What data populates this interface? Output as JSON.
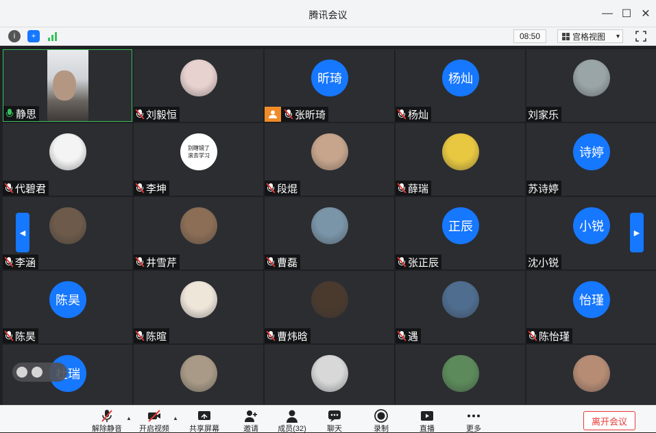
{
  "window": {
    "title": "腾讯会议",
    "minimize": "—",
    "maximize": "☐",
    "close": "✕"
  },
  "toolbar": {
    "info_icon": "info-icon",
    "shield_icon": "shield-icon",
    "signal_icon": "signal-icon",
    "time": "08:50",
    "view_mode": "宫格视图",
    "view_caret": "▾"
  },
  "tiles": [
    {
      "name": "静思",
      "mic": "on",
      "kind": "video"
    },
    {
      "name": "刘毅恒",
      "mic": "muted",
      "kind": "image",
      "color": "#e8d2cf"
    },
    {
      "name": "张昕琦",
      "mic": "muted",
      "kind": "text",
      "avatar_text": "昕琦",
      "host": true
    },
    {
      "name": "杨灿",
      "mic": "muted",
      "kind": "text",
      "avatar_text": "杨灿"
    },
    {
      "name": "刘家乐",
      "mic": "none",
      "kind": "image",
      "color": "#9aa5a8"
    },
    {
      "name": "代碧君",
      "mic": "muted",
      "kind": "image",
      "color": "#f4f4f4"
    },
    {
      "name": "李坤",
      "mic": "muted",
      "kind": "text-image",
      "avatar_text": "别瞎镜了\n滚去学习"
    },
    {
      "name": "段焜",
      "mic": "muted",
      "kind": "image",
      "color": "#c7a58c"
    },
    {
      "name": "薛瑞",
      "mic": "muted",
      "kind": "image",
      "color": "#e8c840"
    },
    {
      "name": "苏诗婷",
      "mic": "none",
      "kind": "text",
      "avatar_text": "诗婷"
    },
    {
      "name": "李涵",
      "mic": "muted",
      "kind": "image",
      "color": "#6d5a4a"
    },
    {
      "name": "井雪芹",
      "mic": "muted",
      "kind": "image",
      "color": "#8b6e55"
    },
    {
      "name": "曹磊",
      "mic": "muted",
      "kind": "image",
      "color": "#7a94a8"
    },
    {
      "name": "张正辰",
      "mic": "muted",
      "kind": "text",
      "avatar_text": "正辰"
    },
    {
      "name": "沈小锐",
      "mic": "none",
      "kind": "text",
      "avatar_text": "小锐"
    },
    {
      "name": "陈昊",
      "mic": "muted",
      "kind": "text",
      "avatar_text": "陈昊"
    },
    {
      "name": "陈暄",
      "mic": "muted",
      "kind": "image",
      "color": "#efe6da"
    },
    {
      "name": "曹炜晗",
      "mic": "muted",
      "kind": "image",
      "color": "#4a3a2e"
    },
    {
      "name": "遇",
      "mic": "muted",
      "kind": "image",
      "color": "#4f6d8f"
    },
    {
      "name": "陈怡瑾",
      "mic": "muted",
      "kind": "text",
      "avatar_text": "怡瑾"
    },
    {
      "name": "",
      "mic": "none",
      "kind": "text",
      "avatar_text": "杜瑞"
    },
    {
      "name": "",
      "mic": "none",
      "kind": "image",
      "color": "#a89a86"
    },
    {
      "name": "",
      "mic": "none",
      "kind": "image",
      "color": "#d8d8d8"
    },
    {
      "name": "",
      "mic": "none",
      "kind": "image",
      "color": "#5c8a5a"
    },
    {
      "name": "",
      "mic": "none",
      "kind": "image",
      "color": "#b68c74"
    }
  ],
  "nav": {
    "prev": "◀",
    "next": "▶"
  },
  "bottom": {
    "items": [
      {
        "label": "解除静音",
        "icon": "mic-muted-icon"
      },
      {
        "label": "开启视频",
        "icon": "video-off-icon"
      },
      {
        "label": "共享屏幕",
        "icon": "share-screen-icon"
      },
      {
        "label": "邀请",
        "icon": "invite-icon"
      },
      {
        "label": "成员(32)",
        "icon": "members-icon"
      },
      {
        "label": "聊天",
        "icon": "chat-icon"
      },
      {
        "label": "录制",
        "icon": "record-icon"
      },
      {
        "label": "直播",
        "icon": "live-icon"
      },
      {
        "label": "更多",
        "icon": "more-icon"
      }
    ],
    "caret": "▲",
    "leave": "离开会议"
  }
}
